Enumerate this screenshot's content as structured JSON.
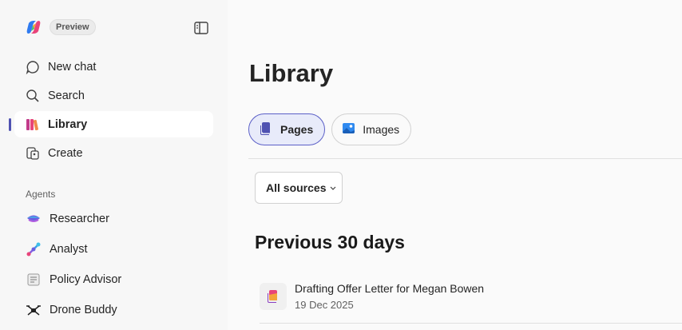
{
  "header": {
    "badge": "Preview"
  },
  "sidebar": {
    "items": [
      {
        "label": "New chat",
        "icon": "chat-bubble-icon"
      },
      {
        "label": "Search",
        "icon": "search-icon"
      },
      {
        "label": "Library",
        "icon": "library-icon",
        "active": true
      },
      {
        "label": "Create",
        "icon": "create-icon"
      }
    ],
    "agents_label": "Agents",
    "agents": [
      {
        "label": "Researcher",
        "icon": "researcher-icon"
      },
      {
        "label": "Analyst",
        "icon": "analyst-icon"
      },
      {
        "label": "Policy Advisor",
        "icon": "policy-advisor-icon"
      },
      {
        "label": "Drone Buddy",
        "icon": "drone-buddy-icon"
      }
    ]
  },
  "main": {
    "title": "Library",
    "tabs": [
      {
        "label": "Pages",
        "icon": "pages-icon",
        "selected": true
      },
      {
        "label": "Images",
        "icon": "images-icon",
        "selected": false
      }
    ],
    "filter": {
      "label": "All sources"
    },
    "section_title": "Previous 30 days",
    "items": [
      {
        "title": "Drafting Offer Letter for Megan Bowen",
        "date": "19 Dec 2025",
        "icon": "page-icon"
      }
    ]
  },
  "colors": {
    "accent": "#5b5fc7",
    "selected_tab_bg": "#e8ebfa",
    "sidebar_bg": "#f7f7f7"
  }
}
